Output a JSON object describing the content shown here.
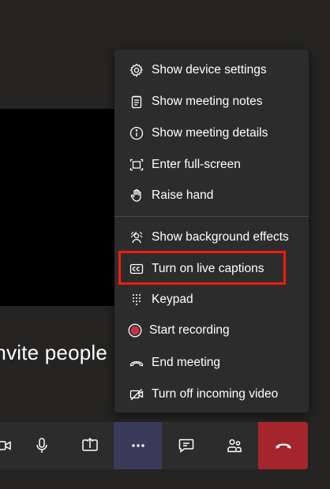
{
  "meeting": {
    "invite_text": "Invite people"
  },
  "menu": {
    "items": [
      {
        "label": "Show device settings",
        "icon": "gear-icon"
      },
      {
        "label": "Show meeting notes",
        "icon": "notes-icon"
      },
      {
        "label": "Show meeting details",
        "icon": "info-icon"
      },
      {
        "label": "Enter full-screen",
        "icon": "fullscreen-icon"
      },
      {
        "label": "Raise hand",
        "icon": "hand-icon"
      },
      {
        "label": "Show background effects",
        "icon": "background-effects-icon"
      },
      {
        "label": "Turn on live captions",
        "icon": "cc-icon"
      },
      {
        "label": "Keypad",
        "icon": "keypad-icon"
      },
      {
        "label": "Start recording",
        "icon": "record-icon"
      },
      {
        "label": "End meeting",
        "icon": "end-meeting-icon"
      },
      {
        "label": "Turn off incoming video",
        "icon": "video-off-icon"
      }
    ]
  },
  "toolbar": {
    "buttons": [
      "camera-icon",
      "microphone-icon",
      "share-screen-icon",
      "more-options-icon",
      "chat-icon",
      "participants-icon",
      "hang-up-icon"
    ]
  },
  "colors": {
    "highlight": "#f21b0c",
    "record": "#c4314b",
    "hangup": "#a4262c",
    "more_active": "#3b3a5a"
  }
}
